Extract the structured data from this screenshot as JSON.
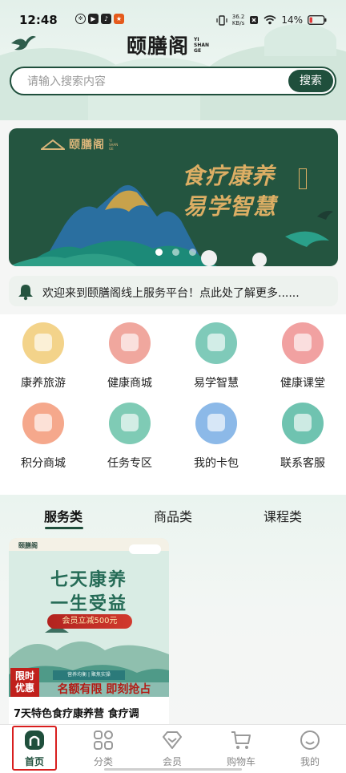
{
  "status_bar": {
    "time": "12:48",
    "network_speed_value": "36.2",
    "network_speed_unit": "KB/s",
    "battery": "14%",
    "notification_icons": [
      "pinwheel-icon",
      "video-app-icon",
      "tiktok-icon",
      "app-badge-icon"
    ]
  },
  "brand": {
    "name": "颐膳阁",
    "pinyin": [
      "YI",
      "SHAN",
      "GE"
    ]
  },
  "search": {
    "placeholder": "请输入搜索内容",
    "button_label": "搜索"
  },
  "banner": {
    "logo_name": "颐膳阁",
    "logo_pinyin": [
      "YI",
      "SHAN",
      "GE"
    ],
    "slogan_line1": "食疗康养",
    "slogan_line2": "易学智慧",
    "slide_count": 3,
    "active_slide": 1
  },
  "notice": {
    "icon": "bell-icon",
    "text": "欢迎来到颐膳阁线上服务平台！点此处了解更多......"
  },
  "menu": {
    "items": [
      {
        "label": "康养旅游",
        "icon": "wellness-travel-icon",
        "color": "#f3d38a"
      },
      {
        "label": "健康商城",
        "icon": "health-mall-icon",
        "color": "#f0a79e"
      },
      {
        "label": "易学智慧",
        "icon": "wisdom-book-icon",
        "color": "#7fcab9"
      },
      {
        "label": "健康课堂",
        "icon": "health-class-icon",
        "color": "#f1a1a1"
      },
      {
        "label": "积分商城",
        "icon": "points-mall-icon",
        "color": "#f5a88c"
      },
      {
        "label": "任务专区",
        "icon": "task-zone-icon",
        "color": "#7fcbb5"
      },
      {
        "label": "我的卡包",
        "icon": "card-wallet-icon",
        "color": "#8cb9e8"
      },
      {
        "label": "联系客服",
        "icon": "customer-service-icon",
        "color": "#6fc3b0"
      }
    ]
  },
  "category_tabs": {
    "items": [
      "服务类",
      "商品类",
      "课程类"
    ],
    "active_index": 0
  },
  "product_card": {
    "logo_text": "颐膳阁",
    "headline_line1": "七天康养",
    "headline_line2": "一生受益",
    "ribbon": "会员立减500元",
    "tags": "营养均衡 | 聚焦实操",
    "badge_line1": "限时",
    "badge_line2": "优惠",
    "promo": "名额有限 即刻抢占",
    "title": "7天特色食疗康养营 食疗调"
  },
  "tab_bar": {
    "items": [
      {
        "label": "首页",
        "icon": "home-icon"
      },
      {
        "label": "分类",
        "icon": "category-grid-icon"
      },
      {
        "label": "会员",
        "icon": "member-diamond-icon"
      },
      {
        "label": "购物车",
        "icon": "shopping-cart-icon"
      },
      {
        "label": "我的",
        "icon": "profile-smile-icon"
      }
    ],
    "active_index": 0
  },
  "colors": {
    "brand_green": "#1f4f3c",
    "banner_green": "#245540",
    "gold": "#dcae64",
    "highlight_red": "#d81e1e"
  }
}
